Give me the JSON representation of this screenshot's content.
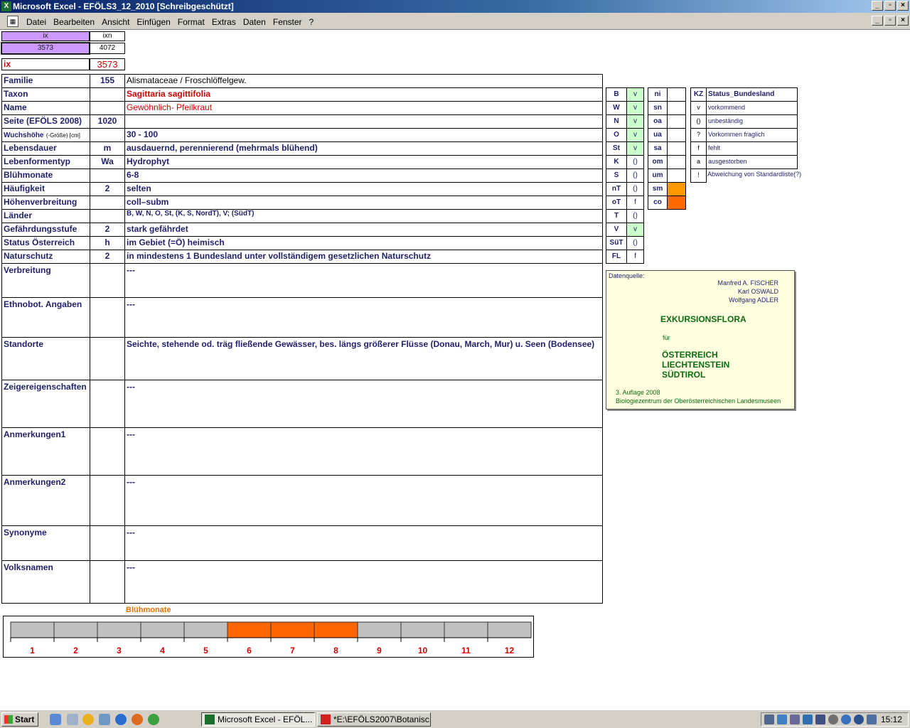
{
  "window": {
    "title": "Microsoft Excel - EFÖLS3_12_2010  [Schreibgeschützt]",
    "btn_min": "_",
    "btn_max": "▫",
    "btn_close": "×"
  },
  "menu": [
    "Datei",
    "Bearbeiten",
    "Ansicht",
    "Einfügen",
    "Format",
    "Extras",
    "Daten",
    "Fenster",
    "?"
  ],
  "top_cells": {
    "ix_header": "ix",
    "ixn_header": "ixn",
    "ix_value": "3573",
    "ixn_value": "4072",
    "ix_label": "ix",
    "ix_big": "3573"
  },
  "rows": [
    {
      "label": "Familie",
      "mid": "155",
      "value": "Alismataceae  /  Froschlöffelgew."
    },
    {
      "label": "Taxon",
      "mid": "",
      "value": "Sagittaria sagittifolia"
    },
    {
      "label": "Name",
      "mid": "",
      "value": "Gewöhnlich- Pfeilkraut"
    },
    {
      "label": "Seite (EFÖLS 2008)",
      "mid": "1020",
      "value": ""
    },
    {
      "label": "Wuchshöhe",
      "label_suffix": "(-Größe) [cm]",
      "mid": "",
      "value": " 30 - 100"
    },
    {
      "label": "Lebensdauer",
      "mid": "m",
      "value": "ausdauernd, perennierend (mehrmals blühend)"
    },
    {
      "label": "Lebenformentyp",
      "mid": "Wa",
      "value": "Hydrophyt"
    },
    {
      "label": "Blühmonate",
      "mid": "",
      "value": " 6-8"
    },
    {
      "label": "Häufigkeit",
      "mid": "2",
      "value": "selten"
    },
    {
      "label": "Höhenverbreitung",
      "mid": "",
      "value": "coll–subm"
    },
    {
      "label": "Länder",
      "mid": "",
      "value": "B, W, N, O, St, (K, S, NordT), V; (SüdT)"
    },
    {
      "label": "Gefährdungsstufe",
      "mid": "2",
      "value": "stark gefährdet"
    },
    {
      "label": "Status Österreich",
      "mid": "h",
      "value": "im Gebiet (=Ö) heimisch"
    },
    {
      "label": "Naturschutz",
      "mid": "2",
      "value": "in mindestens 1 Bundesland unter vollständigem gesetzlichen Naturschutz"
    }
  ],
  "bigrows": [
    {
      "label": "Verbreitung",
      "value": " ---"
    },
    {
      "label": "Ethnobot. Angaben",
      "value": "---"
    },
    {
      "label": "Standorte",
      "value": "Seichte, stehende od. träg fließende Gewässer, bes. längs größerer Flüsse (Donau, March, Mur) u. Seen (Bodensee)"
    },
    {
      "label": "Zeigereigenschaften",
      "value": "---"
    },
    {
      "label": "Anmerkungen1",
      "value": "---"
    },
    {
      "label": "Anmerkungen2",
      "value": "---"
    },
    {
      "label": "Synonyme",
      "value": "---"
    },
    {
      "label": "Volksnamen",
      "value": "---"
    }
  ],
  "states": [
    {
      "code": "B",
      "status": "v",
      "hl": "green"
    },
    {
      "code": "W",
      "status": "v",
      "hl": "green"
    },
    {
      "code": "N",
      "status": "v",
      "hl": "green"
    },
    {
      "code": "O",
      "status": "v",
      "hl": "green"
    },
    {
      "code": "St",
      "status": "v",
      "hl": "green"
    },
    {
      "code": "K",
      "status": "()",
      "hl": ""
    },
    {
      "code": "S",
      "status": "()",
      "hl": ""
    },
    {
      "code": "nT",
      "status": "()",
      "hl": ""
    },
    {
      "code": "oT",
      "status": "f",
      "hl": ""
    },
    {
      "code": "T",
      "status": "()",
      "hl": ""
    },
    {
      "code": "V",
      "status": "v",
      "hl": "green"
    },
    {
      "code": "SüT",
      "status": "()",
      "hl": ""
    },
    {
      "code": "FL",
      "status": "f",
      "hl": ""
    }
  ],
  "altitudes": [
    {
      "code": "ni",
      "hl": ""
    },
    {
      "code": "sn",
      "hl": ""
    },
    {
      "code": "oa",
      "hl": ""
    },
    {
      "code": "ua",
      "hl": ""
    },
    {
      "code": "sa",
      "hl": ""
    },
    {
      "code": "om",
      "hl": ""
    },
    {
      "code": "um",
      "hl": ""
    },
    {
      "code": "sm",
      "hl": "orange"
    },
    {
      "code": "co",
      "hl": "orange2"
    }
  ],
  "legend": {
    "kz_header": "KZ",
    "status_header": "Status_Bundesland",
    "items": [
      {
        "kz": "v",
        "text": "vorkommend"
      },
      {
        "kz": "()",
        "text": "unbeständig"
      },
      {
        "kz": "?",
        "text": "Vorkommen fraglich"
      },
      {
        "kz": "f",
        "text": "fehlt"
      },
      {
        "kz": "a",
        "text": "ausgestorben"
      },
      {
        "kz": "!",
        "text": "Abweichung von Standardliste(?)"
      }
    ]
  },
  "source_box": {
    "label": "Datenquelle:",
    "authors": [
      "Manfred A. FISCHER",
      "Karl OSWALD",
      "Wolfgang ADLER"
    ],
    "title": "EXKURSIONSFLORA",
    "fuer": "für",
    "regions": [
      "ÖSTERREICH",
      "LIECHTENSTEIN",
      "SÜDTIROL"
    ],
    "edition": "3. Auflage 2008",
    "publisher": "Biologiezentrum der Oberösterreichischen Landesmuseen"
  },
  "bloom_chart": {
    "title": "Blühmonate",
    "months": [
      "1",
      "2",
      "3",
      "4",
      "5",
      "6",
      "7",
      "8",
      "9",
      "10",
      "11",
      "12"
    ],
    "active": [
      false,
      false,
      false,
      false,
      false,
      true,
      true,
      true,
      false,
      false,
      false,
      false
    ],
    "active_color": "#ff6600",
    "inactive_color": "#c0c0c0"
  },
  "taskbar": {
    "start": "Start",
    "tasks": [
      "Microsoft Excel - EFÖL...",
      "*E:\\EFÖLS2007\\Botanisc..."
    ],
    "clock": "15:12"
  }
}
